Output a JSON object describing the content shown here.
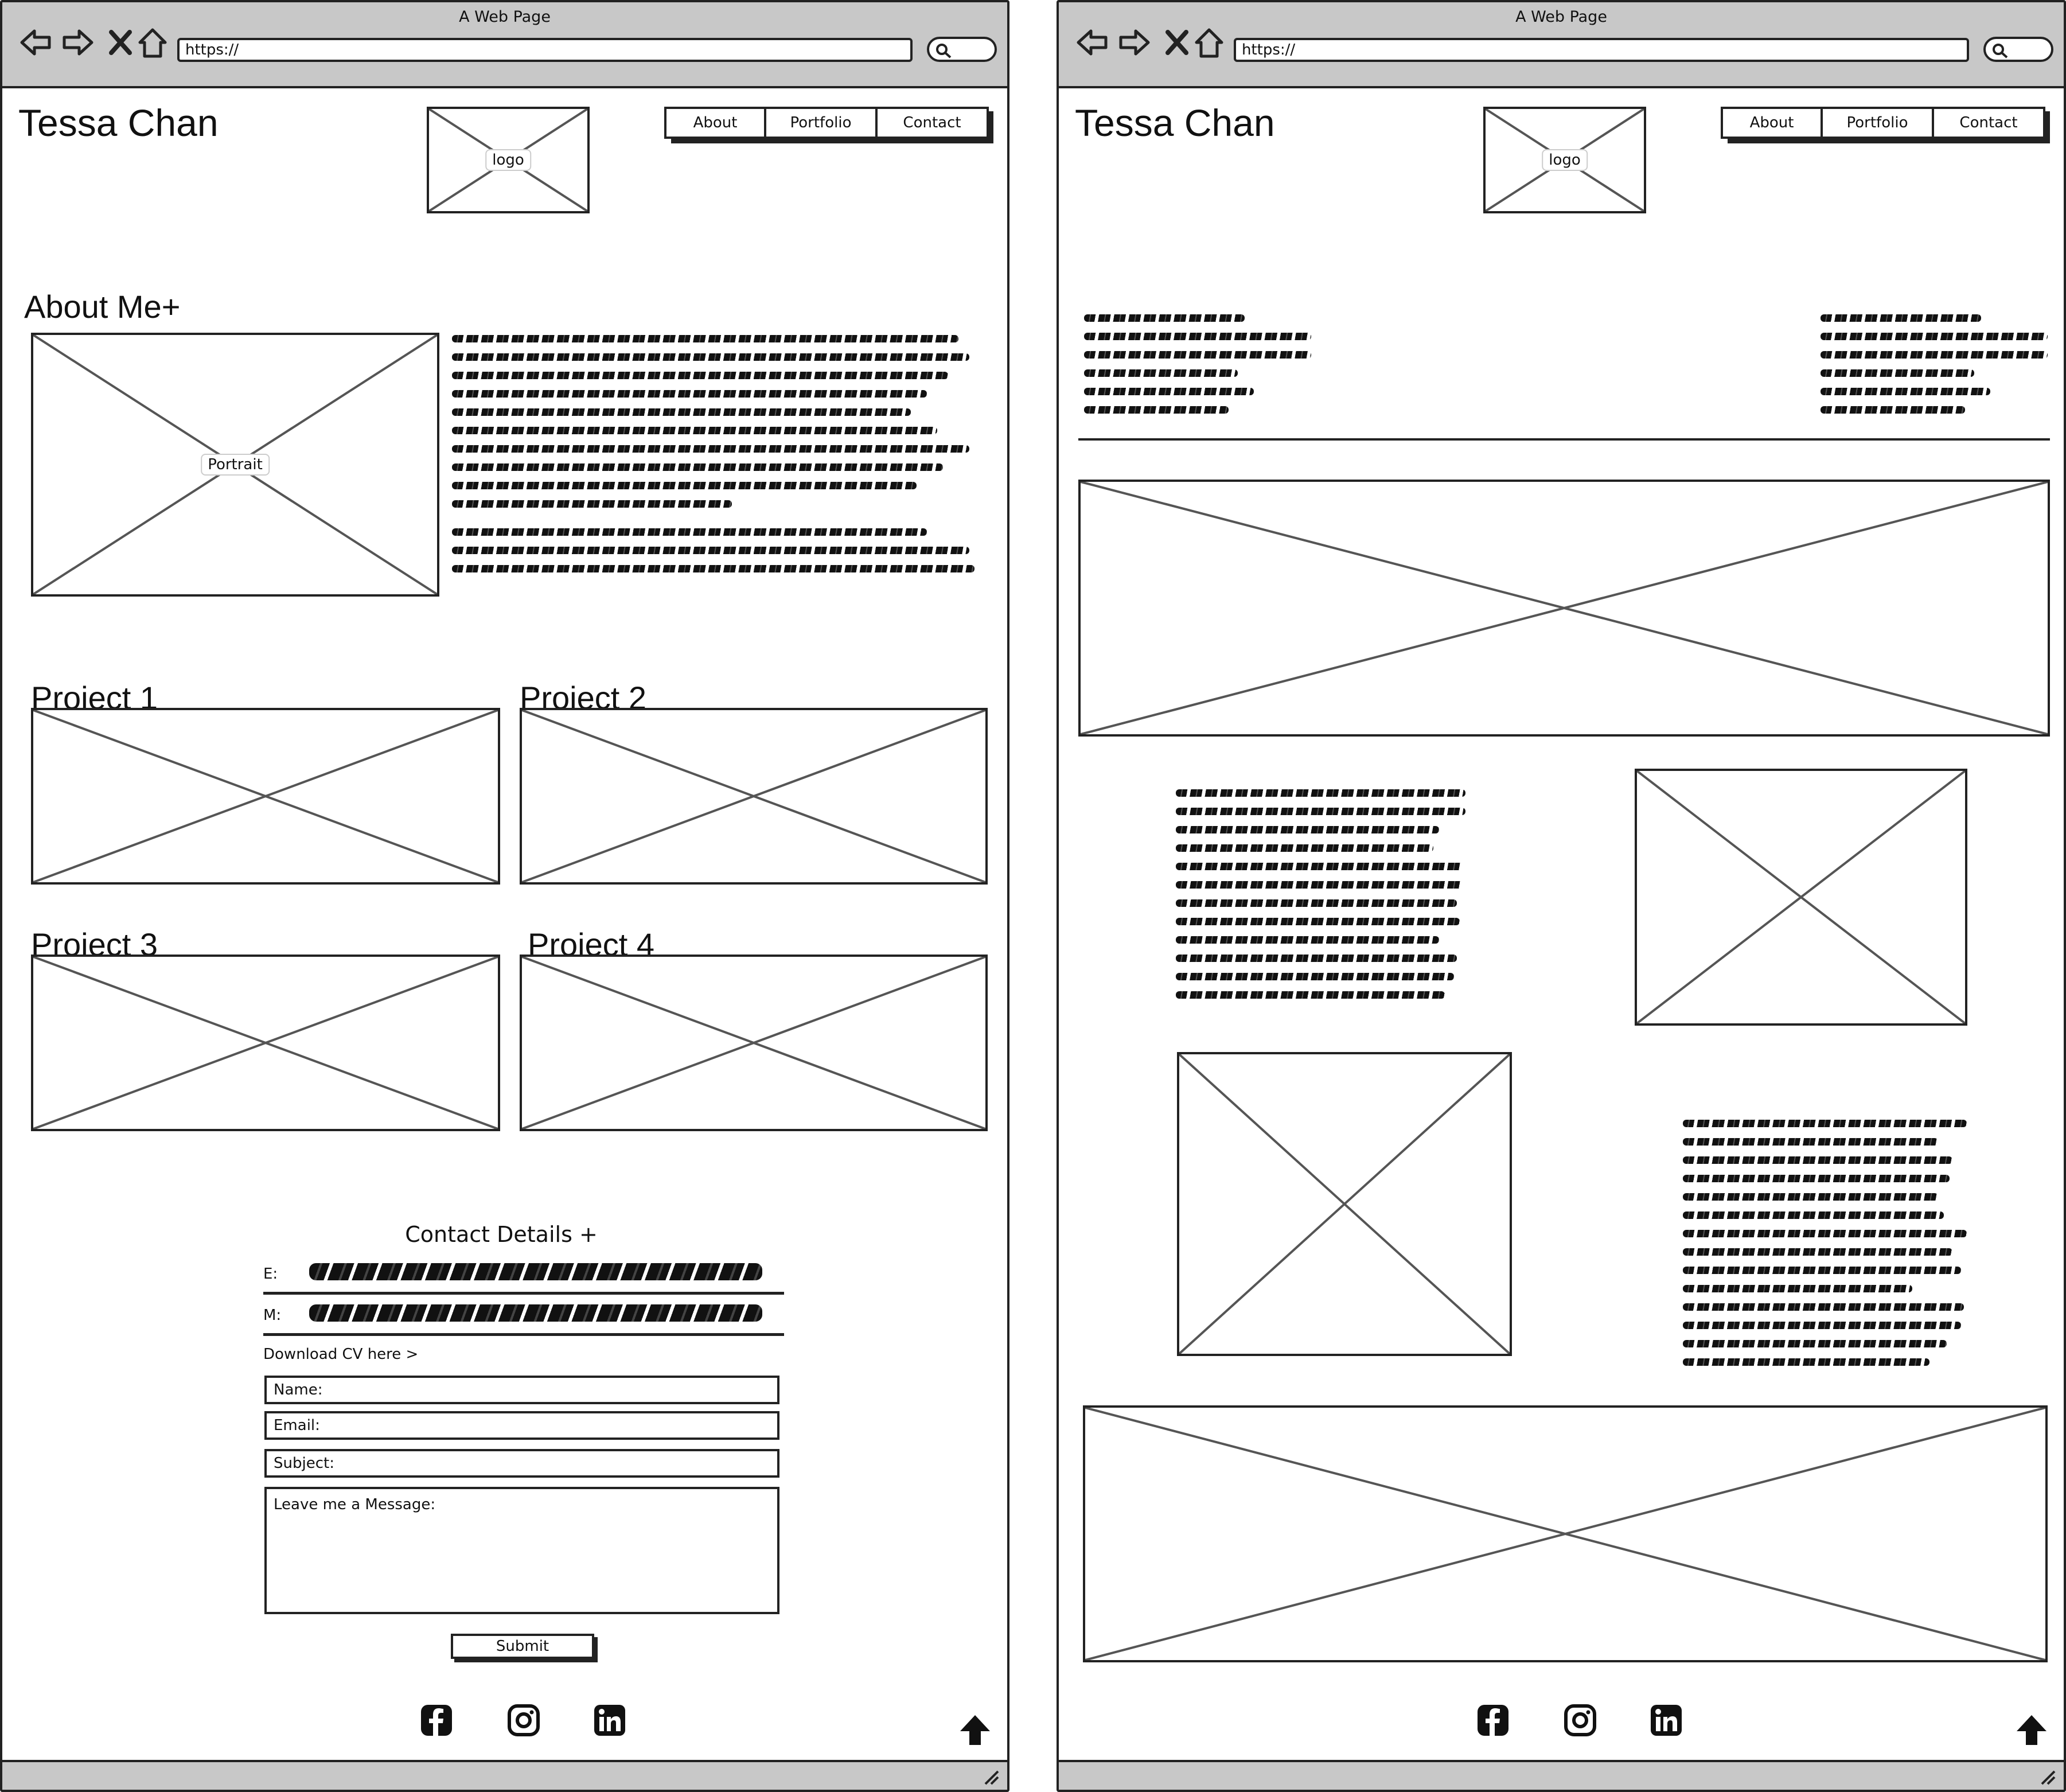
{
  "browser": {
    "window_title": "A Web Page",
    "url": "https://",
    "icons": [
      "back-arrow-icon",
      "forward-arrow-icon",
      "close-x-icon",
      "home-icon",
      "search-icon"
    ]
  },
  "site": {
    "name": "Tessa Chan",
    "logo_label": "logo",
    "nav": [
      {
        "label": "About"
      },
      {
        "label": "Portfolio"
      },
      {
        "label": "Contact"
      }
    ]
  },
  "home": {
    "about_title": "About Me+",
    "portrait_label": "Portrait",
    "projects": [
      {
        "title": "Project 1"
      },
      {
        "title": "Project 2"
      },
      {
        "title": "Project 3"
      },
      {
        "title": "Project 4"
      }
    ],
    "contact": {
      "title": "Contact Details +",
      "email_label": "E:",
      "mobile_label": "M:",
      "download_cv": "Download CV here >",
      "name_placeholder": "Name:",
      "email_placeholder": "Email:",
      "subject_placeholder": "Subject:",
      "message_placeholder": "Leave me a Message:",
      "submit_label": "Submit"
    }
  },
  "social_icons": [
    "facebook-icon",
    "instagram-icon",
    "linkedin-icon"
  ],
  "back_to_top_icon": "arrow-up-icon",
  "colors": {
    "chrome": "#c8c8c8",
    "ink": "#222222",
    "placeholder_cross": "#555555"
  }
}
